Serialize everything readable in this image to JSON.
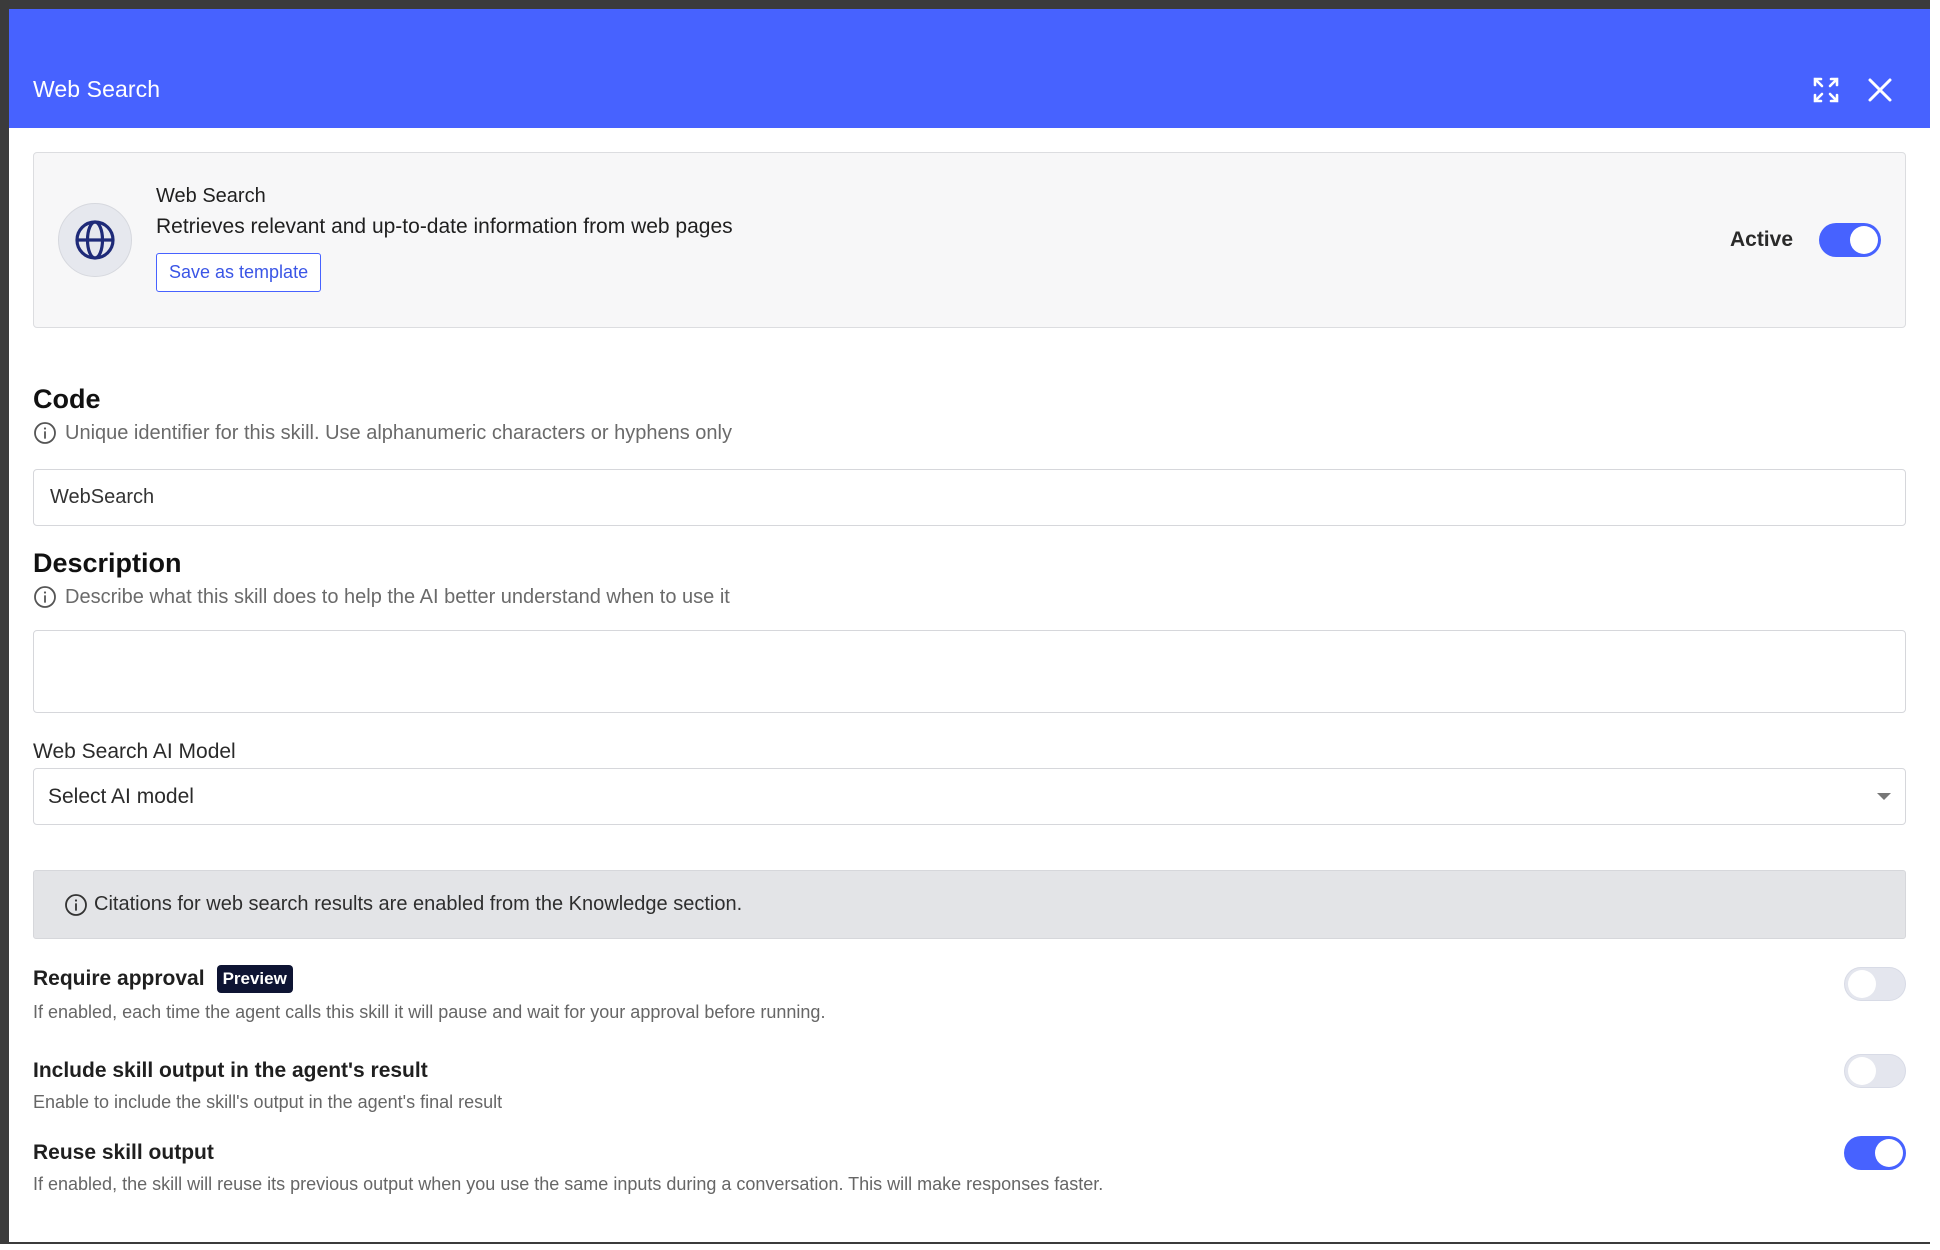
{
  "modal": {
    "title": "Web Search"
  },
  "skill": {
    "name": "Web Search",
    "description": "Retrieves relevant and up-to-date information from web pages",
    "template_button": "Save as template",
    "active_label": "Active",
    "active": true,
    "icon": "globe-icon"
  },
  "code": {
    "title": "Code",
    "hint": "Unique identifier for this skill. Use alphanumeric characters or hyphens only",
    "value": "WebSearch"
  },
  "description": {
    "title": "Description",
    "hint": "Describe what this skill does to help the AI better understand when to use it",
    "value": ""
  },
  "model": {
    "label": "Web Search AI Model",
    "placeholder": "Select AI model"
  },
  "notice": {
    "text": "Citations for web search results are enabled from the Knowledge section."
  },
  "options": [
    {
      "title": "Require approval",
      "badge": "Preview",
      "description": "If enabled, each time the agent calls this skill it will pause and wait for your approval before running.",
      "enabled": false
    },
    {
      "title": "Include skill output in the agent's result",
      "description": "Enable to include the skill's output in the agent's final result",
      "enabled": false
    },
    {
      "title": "Reuse skill output",
      "description": "If enabled, the skill will reuse its previous output when you use the same inputs during a conversation. This will make responses faster.",
      "enabled": true
    }
  ],
  "colors": {
    "accent": "#4762ff",
    "badge_bg": "#0e1433",
    "notice_bg": "#e3e4e7"
  }
}
